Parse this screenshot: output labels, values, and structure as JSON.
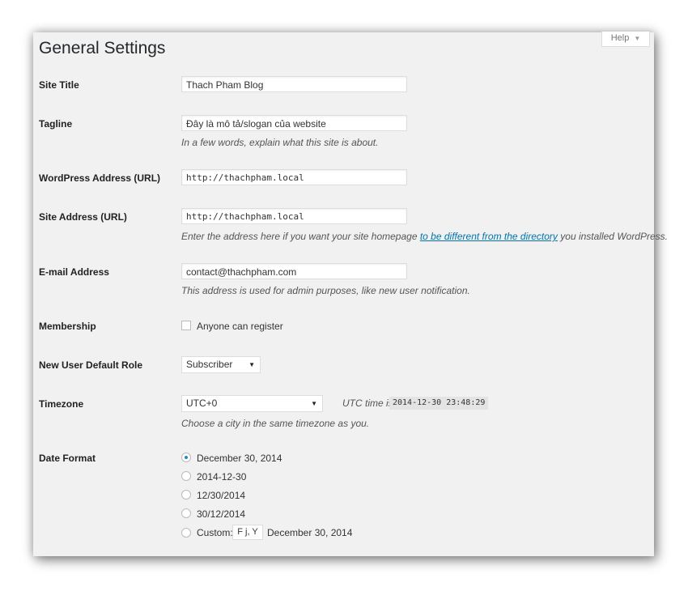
{
  "help": {
    "label": "Help",
    "caret": "▼"
  },
  "page": {
    "title": "General Settings"
  },
  "site_title": {
    "label": "Site Title",
    "value": "Thach Pham Blog"
  },
  "tagline": {
    "label": "Tagline",
    "value": "Đây là mô tả/slogan của website",
    "description": "In a few words, explain what this site is about."
  },
  "wp_address": {
    "label": "WordPress Address (URL)",
    "value": "http://thachpham.local"
  },
  "site_address": {
    "label": "Site Address (URL)",
    "value": "http://thachpham.local",
    "desc_before": "Enter the address here if you want your site homepage ",
    "desc_link": "to be different from the directory",
    "desc_after": " you installed WordPress."
  },
  "email": {
    "label": "E-mail Address",
    "value": "contact@thachpham.com",
    "description": "This address is used for admin purposes, like new user notification."
  },
  "membership": {
    "label": "Membership",
    "checkbox_label": "Anyone can register",
    "checked": false
  },
  "default_role": {
    "label": "New User Default Role",
    "selected": "Subscriber"
  },
  "timezone": {
    "label": "Timezone",
    "selected": "UTC+0",
    "utc_label": "UTC time is",
    "utc_value": "2014-12-30 23:48:29",
    "description": "Choose a city in the same timezone as you."
  },
  "date_format": {
    "label": "Date Format",
    "options": [
      {
        "label": "December 30, 2014",
        "checked": true
      },
      {
        "label": "2014-12-30",
        "checked": false
      },
      {
        "label": "12/30/2014",
        "checked": false
      },
      {
        "label": "30/12/2014",
        "checked": false
      }
    ],
    "custom_label": "Custom:",
    "custom_value": "F j, Y",
    "custom_preview": "December 30, 2014"
  },
  "colors": {
    "link": "#0073aa",
    "radio_dot": "#1e8cbe",
    "panel_bg": "#f1f1f1"
  }
}
